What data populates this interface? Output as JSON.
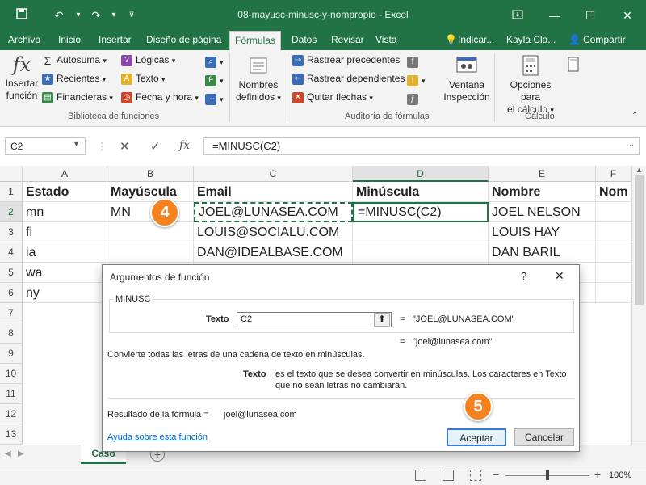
{
  "titlebar": {
    "title": "08-mayusc-minusc-y-nompropio  -  Excel"
  },
  "tabs": [
    "Archivo",
    "Inicio",
    "Insertar",
    "Diseño de página",
    "Fórmulas",
    "Datos",
    "Revisar",
    "Vista"
  ],
  "tell_me": "Indicar...",
  "user": "Kayla Cla...",
  "share": "Compartir",
  "ribbon": {
    "insert_function": [
      "Insertar",
      "función"
    ],
    "lib_col1": [
      "Autosuma",
      "Recientes",
      "Financieras"
    ],
    "lib_col2": [
      "Lógicas",
      "Texto",
      "Fecha y hora"
    ],
    "lib_group": "Biblioteca de funciones",
    "defined_names": [
      "Nombres",
      "definidos"
    ],
    "audit": [
      "Rastrear precedentes",
      "Rastrear dependientes",
      "Quitar flechas"
    ],
    "watch": [
      "Ventana",
      "Inspección"
    ],
    "audit_group": "Auditoría de fórmulas",
    "calc_options": [
      "Opciones para",
      "el cálculo"
    ],
    "calc_group": "Cálculo"
  },
  "formula_bar": {
    "name_box": "C2",
    "fx": "fx",
    "formula": "=MINUSC(C2)"
  },
  "columns": [
    "A",
    "B",
    "C",
    "D",
    "E",
    "F"
  ],
  "rows": [
    "1",
    "2",
    "3",
    "4",
    "5",
    "6",
    "7",
    "8",
    "9",
    "10",
    "11",
    "12",
    "13"
  ],
  "cells": {
    "r1": [
      "Estado",
      "Mayúscula",
      "Email",
      "Minúscula",
      "Nombre",
      "Nom"
    ],
    "r2": [
      "mn",
      "MN",
      "JOEL@LUNASEA.COM",
      "=MINUSC(C2)",
      "JOEL NELSON",
      ""
    ],
    "r3": [
      "fl",
      "",
      "LOUIS@SOCIALU.COM",
      "",
      "LOUIS HAY",
      ""
    ],
    "r4": [
      "ia",
      "",
      "DAN@IDEALBASE.COM",
      "",
      "DAN BARIL",
      ""
    ],
    "r5": [
      "wa",
      "",
      "",
      "",
      "",
      ""
    ],
    "r6": [
      "ny",
      "",
      "",
      "",
      "",
      ""
    ]
  },
  "sheet_tab": "Caso",
  "zoom": "100%",
  "badges": {
    "step4": "4",
    "step5": "5"
  },
  "dialog": {
    "title": "Argumentos de función",
    "help_q": "?",
    "function_name": "MINUSC",
    "arg_label": "Texto",
    "arg_value": "C2",
    "arg_result": "\"JOEL@LUNASEA.COM\"",
    "result_preview": "\"joel@lunasea.com\"",
    "description": "Convierte todas las letras de una cadena de texto en minúsculas.",
    "arg_desc_label": "Texto",
    "arg_desc_1": "es el texto que se desea convertir en minúsculas. Los caracteres en Texto",
    "arg_desc_2": "que no sean letras no cambiarán.",
    "formula_result_label": "Resultado de la fórmula =",
    "formula_result": "joel@lunasea.com",
    "help_link": "Ayuda sobre esta función",
    "ok": "Aceptar",
    "cancel": "Cancelar"
  },
  "colors": {
    "excel_green": "#217346",
    "badge_orange": "#f5821f"
  }
}
